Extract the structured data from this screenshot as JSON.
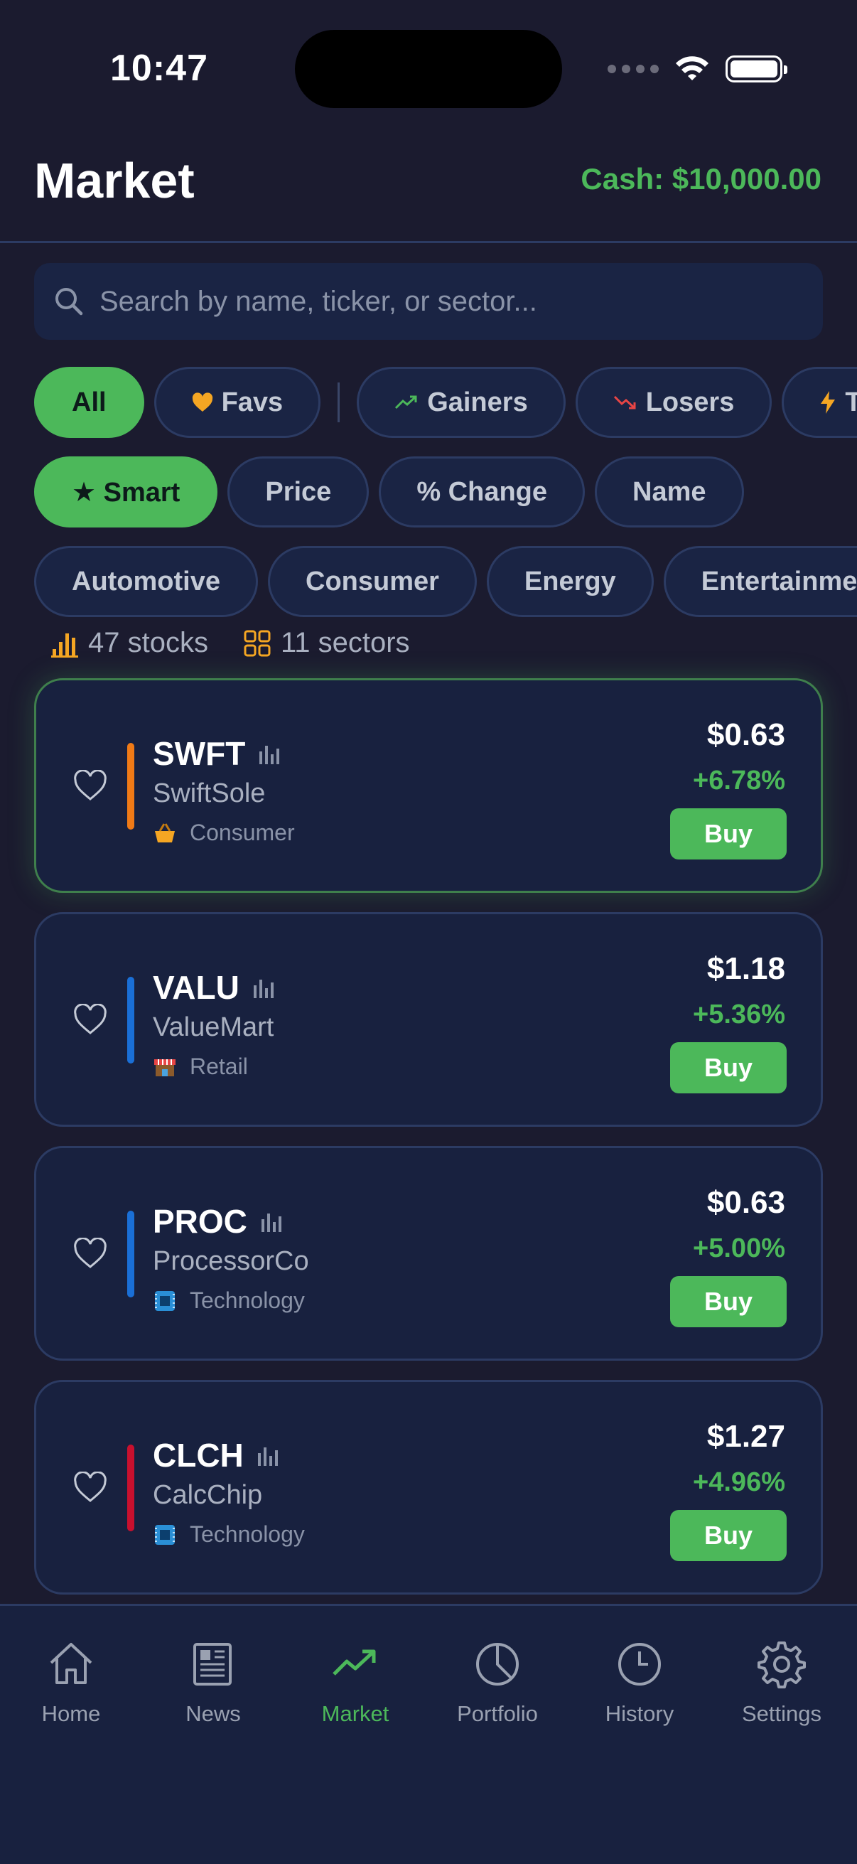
{
  "status_bar": {
    "time": "10:47"
  },
  "header": {
    "title": "Market",
    "cash": "Cash: $10,000.00"
  },
  "search": {
    "placeholder": "Search by name, ticker, or sector..."
  },
  "filters": [
    {
      "label": "All",
      "icon": null,
      "active": true
    },
    {
      "label": "Favs",
      "icon": "heart-icon",
      "active": false
    },
    {
      "label": "Gainers",
      "icon": "trend-up-icon",
      "active": false
    },
    {
      "label": "Losers",
      "icon": "trend-down-icon",
      "active": false
    },
    {
      "label": "To",
      "icon": "lightning-icon",
      "active": false
    }
  ],
  "sorts": [
    {
      "label": "★ Smart",
      "active": true
    },
    {
      "label": "Price",
      "active": false
    },
    {
      "label": "% Change",
      "active": false
    },
    {
      "label": "Name",
      "active": false
    }
  ],
  "sectors": [
    "Automotive",
    "Consumer",
    "Energy",
    "Entertainme"
  ],
  "summary": {
    "stocks": "47 stocks",
    "sectors": "11 sectors"
  },
  "stocks": [
    {
      "ticker": "SWFT",
      "name": "SwiftSole",
      "sector": "Consumer",
      "sector_icon": "basket-icon",
      "price": "$0.63",
      "change": "+6.78%",
      "buy": "Buy",
      "bar_color": "#f07a16"
    },
    {
      "ticker": "VALU",
      "name": "ValueMart",
      "sector": "Retail",
      "sector_icon": "store-icon",
      "price": "$1.18",
      "change": "+5.36%",
      "buy": "Buy",
      "bar_color": "#1a6fd6"
    },
    {
      "ticker": "PROC",
      "name": "ProcessorCo",
      "sector": "Technology",
      "sector_icon": "chip-icon",
      "price": "$0.63",
      "change": "+5.00%",
      "buy": "Buy",
      "bar_color": "#1a6fd6"
    },
    {
      "ticker": "CLCH",
      "name": "CalcChip",
      "sector": "Technology",
      "sector_icon": "chip-icon",
      "price": "$1.27",
      "change": "+4.96%",
      "buy": "Buy",
      "bar_color": "#c8102e"
    }
  ],
  "tabs": [
    {
      "label": "Home",
      "icon": "home-icon"
    },
    {
      "label": "News",
      "icon": "newspaper-icon"
    },
    {
      "label": "Market",
      "icon": "trend-up-icon",
      "active": true
    },
    {
      "label": "Portfolio",
      "icon": "pie-chart-icon"
    },
    {
      "label": "History",
      "icon": "clock-icon"
    },
    {
      "label": "Settings",
      "icon": "gear-icon"
    }
  ],
  "colors": {
    "accent": "#4cb85a",
    "background": "#1b1b2f",
    "card": "#18213f",
    "favs_heart": "#f5a623"
  }
}
